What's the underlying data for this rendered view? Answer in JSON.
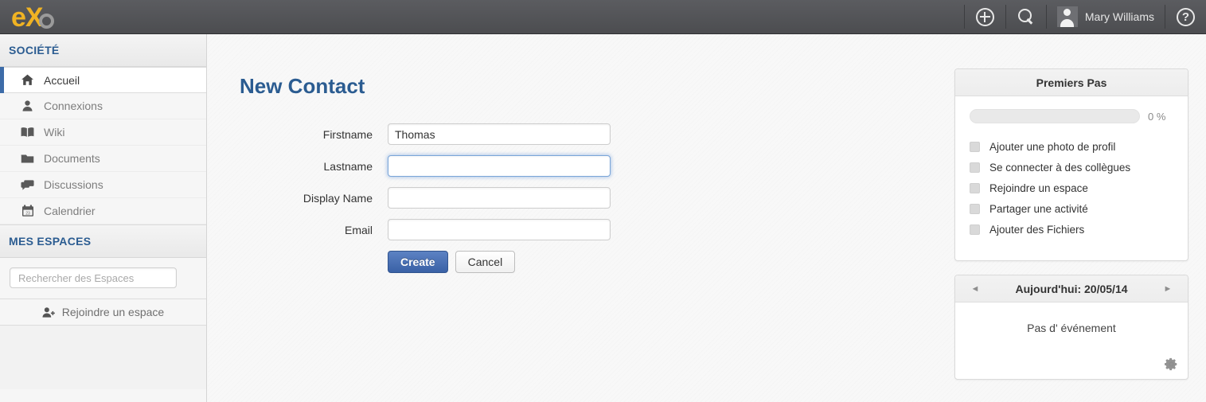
{
  "topbar": {
    "logo": {
      "part1": "e",
      "part2": "X",
      "part3": "o-circle"
    },
    "add_icon": "plus-circle-icon",
    "search_icon": "search-icon",
    "user_name": "Mary Williams",
    "help_icon": "help-icon",
    "help_glyph": "?"
  },
  "sidebar": {
    "societe_header": "SOCIÉTÉ",
    "nav_items": [
      {
        "label": "Accueil",
        "icon": "home-icon",
        "active": true
      },
      {
        "label": "Connexions",
        "icon": "person-icon",
        "active": false
      },
      {
        "label": "Wiki",
        "icon": "book-icon",
        "active": false
      },
      {
        "label": "Documents",
        "icon": "folder-icon",
        "active": false
      },
      {
        "label": "Discussions",
        "icon": "chat-icon",
        "active": false
      },
      {
        "label": "Calendrier",
        "icon": "calendar-icon",
        "active": false
      }
    ],
    "espaces_header": "MES ESPACES",
    "search_placeholder": "Rechercher des Espaces",
    "search_value": "",
    "join_space_label": "Rejoindre un espace",
    "join_space_icon": "add-person-icon"
  },
  "main": {
    "page_title": "New Contact",
    "form": {
      "fields": [
        {
          "label": "Firstname",
          "value": "Thomas",
          "focused": false
        },
        {
          "label": "Lastname",
          "value": "",
          "focused": true
        },
        {
          "label": "Display Name",
          "value": "",
          "focused": false
        },
        {
          "label": "Email",
          "value": "",
          "focused": false
        }
      ],
      "create_label": "Create",
      "cancel_label": "Cancel"
    }
  },
  "panels": {
    "getting_started": {
      "title": "Premiers Pas",
      "progress_percent": 0,
      "progress_label": "0 %",
      "tasks": [
        {
          "label": "Ajouter une photo de profil",
          "checked": false
        },
        {
          "label": "Se connecter à des collègues",
          "checked": false
        },
        {
          "label": "Rejoindre un espace",
          "checked": false
        },
        {
          "label": "Partager une activité",
          "checked": false
        },
        {
          "label": "Ajouter des Fichiers",
          "checked": false
        }
      ]
    },
    "agenda": {
      "title": "Aujourd'hui: 20/05/14",
      "prev_arrow": "◄",
      "next_arrow": "►",
      "empty_text": "Pas d' événement",
      "settings_icon": "gear-icon"
    }
  },
  "colors": {
    "accent_blue": "#2b5c91",
    "button_blue": "#3a61a6",
    "logo_yellow": "#f0b323",
    "topbar_dark": "#55565a"
  }
}
